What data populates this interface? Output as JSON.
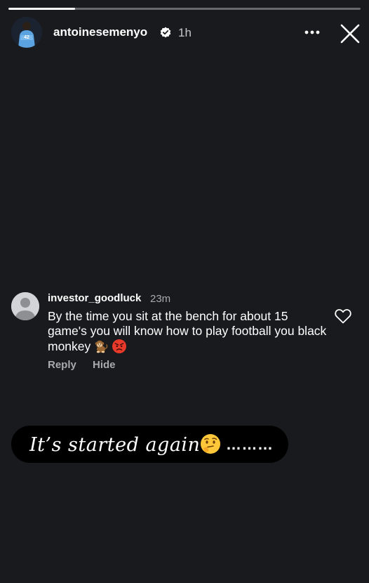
{
  "story": {
    "progress": 0.19
  },
  "header": {
    "username": "antoinesemenyo",
    "verified": true,
    "time": "1h",
    "avatar_icon": "avatar-player-photo",
    "more_icon": "more-horizontal-icon",
    "close_icon": "close-icon"
  },
  "comment": {
    "username": "investor_goodluck",
    "time": "23m",
    "text": "By the time you sit at the bench for about 15 game's you will know how to play football you black monkey",
    "emojis": [
      "monkey-emoji",
      "angry-face-emoji"
    ],
    "like_icon": "heart-outline-icon",
    "reply_label": "Reply",
    "hide_label": "Hide"
  },
  "caption": {
    "text": "It’s started again",
    "emoji": "thinking-face-emoji",
    "trailing": "………"
  },
  "colors": {
    "background": "#181a1d",
    "caption_bubble": "#000000",
    "secondary_text": "#a8aaad",
    "avatar_placeholder": "#d3d4d7"
  }
}
